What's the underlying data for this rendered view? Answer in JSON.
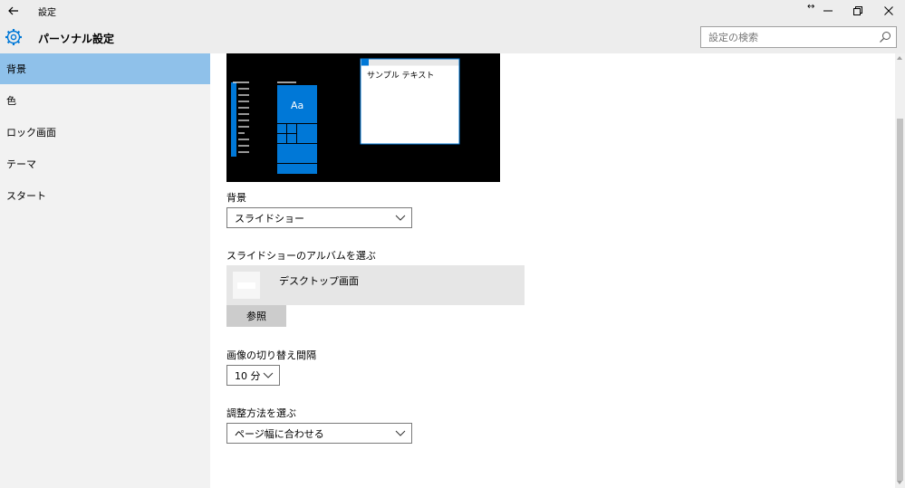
{
  "window": {
    "title": "設定",
    "back_icon": "back-arrow-icon",
    "minimize_icon": "minimize-icon",
    "restore_icon": "restore-icon",
    "close_icon": "close-icon",
    "resize_hint_icon": "resize-horizontal-icon",
    "resize_hint": "↔"
  },
  "header": {
    "icon": "gear-icon",
    "title": "パーソナル設定",
    "search_placeholder": "設定の検索",
    "search_icon": "search-icon"
  },
  "sidebar": {
    "items": [
      {
        "label": "背景",
        "active": true
      },
      {
        "label": "色",
        "active": false
      },
      {
        "label": "ロック画面",
        "active": false
      },
      {
        "label": "テーマ",
        "active": false
      },
      {
        "label": "スタート",
        "active": false
      }
    ]
  },
  "preview": {
    "sample_window_text": "サンプル テキスト",
    "tile_label": "Aa"
  },
  "background": {
    "label": "背景",
    "selected": "スライドショー"
  },
  "album": {
    "label": "スライドショーのアルバムを選ぶ",
    "folder_name": "デスクトップ画面",
    "browse_label": "参照"
  },
  "interval": {
    "label": "画像の切り替え間隔",
    "selected": "10 分"
  },
  "fit": {
    "label": "調整方法を選ぶ",
    "selected": "ページ幅に合わせる"
  },
  "colors": {
    "accent": "#0078d7",
    "nav_selected": "#8fc1ea",
    "chrome": "#ededed"
  }
}
